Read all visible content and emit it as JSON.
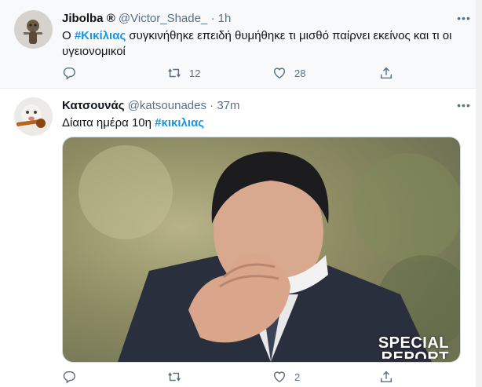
{
  "tweets": [
    {
      "name": "Jibolba",
      "name_badge": "®",
      "handle": "@Victor_Shade_",
      "separator": "·",
      "time": "1h",
      "more": "•••",
      "text_before": "Ο ",
      "hashtag": "#Κικίλιας",
      "text_after": " συγκινήθηκε επειδή θυμήθηκε τι μισθό παίρνει εκείνος και τι οι υγειονομικοί",
      "replies": "",
      "retweets": "12",
      "likes": "28"
    },
    {
      "name": "Κατσουνάς",
      "handle": "@katsounades",
      "separator": "·",
      "time": "37m",
      "more": "•••",
      "text_before": "Δίαιτα ημέρα 10η ",
      "hashtag": "#κικιλιας",
      "text_after": "",
      "media_caption_line1": "SPECIAL",
      "media_caption_line2": "REPORT",
      "replies": "",
      "retweets": "",
      "likes": "2"
    }
  ],
  "icons": [
    "reply-icon",
    "retweet-icon",
    "like-icon",
    "share-icon",
    "more-icon"
  ],
  "colors": {
    "link": "#1b95e0",
    "muted": "#5b7083",
    "text": "#0f1419",
    "hover_bg": "#f7f9fa"
  }
}
